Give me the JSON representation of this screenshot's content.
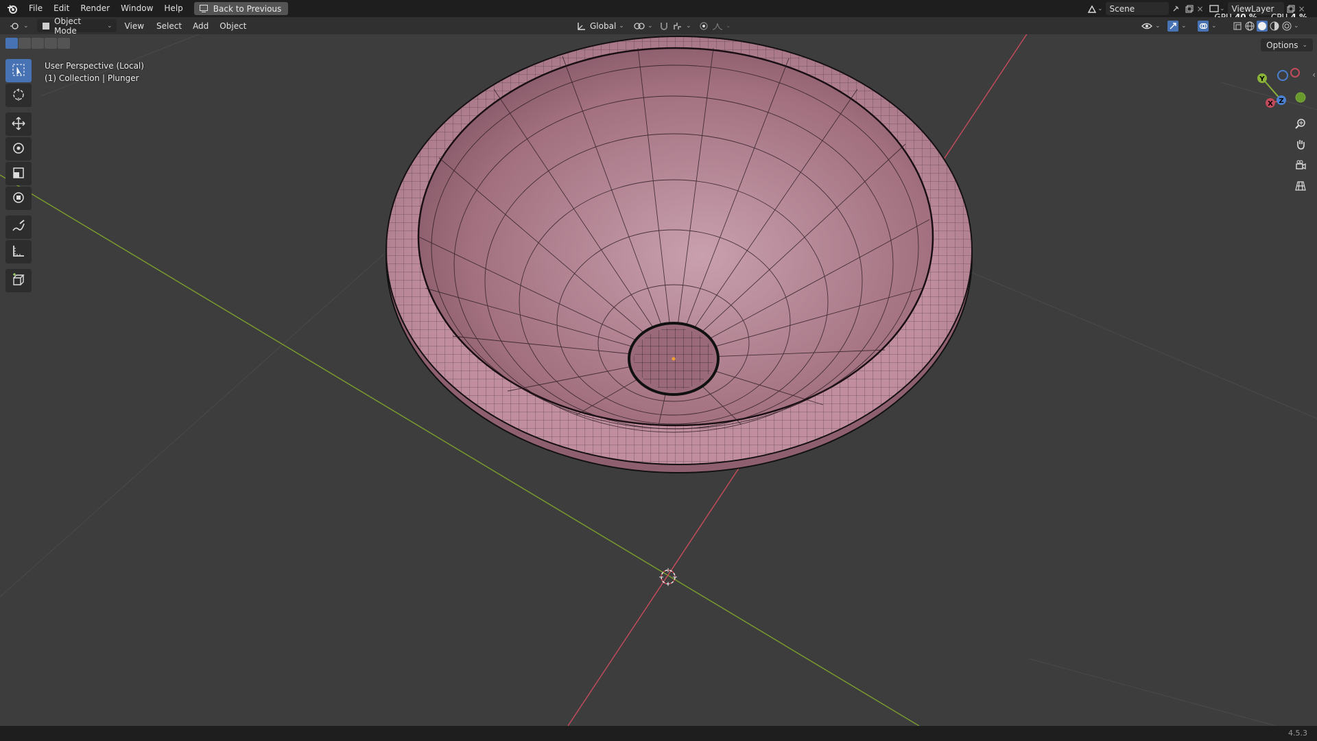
{
  "menu": [
    "File",
    "Edit",
    "Render",
    "Window",
    "Help"
  ],
  "back_button": "Back to Previous",
  "scene": {
    "label": "Scene",
    "view_layer": "ViewLayer"
  },
  "stats": {
    "gpu_label": "GPU",
    "gpu_value": "40 %",
    "cpu_label": "CPU",
    "cpu_value": "4 %"
  },
  "header": {
    "mode": "Object Mode",
    "menus": [
      "View",
      "Select",
      "Add",
      "Object"
    ],
    "transform_orientation": "Global"
  },
  "viewport": {
    "perspective": "User Perspective (Local)",
    "collection": "(1) Collection | Plunger"
  },
  "options_label": "Options",
  "gizmo_axes": {
    "x": "X",
    "y": "Y",
    "z": "Z"
  },
  "version": "4.5.3",
  "colors": {
    "accent": "#4772b3",
    "mesh": "#b58495",
    "x_axis": "#c24b5b",
    "y_axis": "#7a9a2e"
  },
  "toolbar_icons": [
    "select-box-icon",
    "cursor-icon",
    "move-icon",
    "rotate-icon",
    "scale-icon",
    "transform-icon",
    "annotate-icon",
    "measure-icon",
    "add-cube-icon"
  ]
}
